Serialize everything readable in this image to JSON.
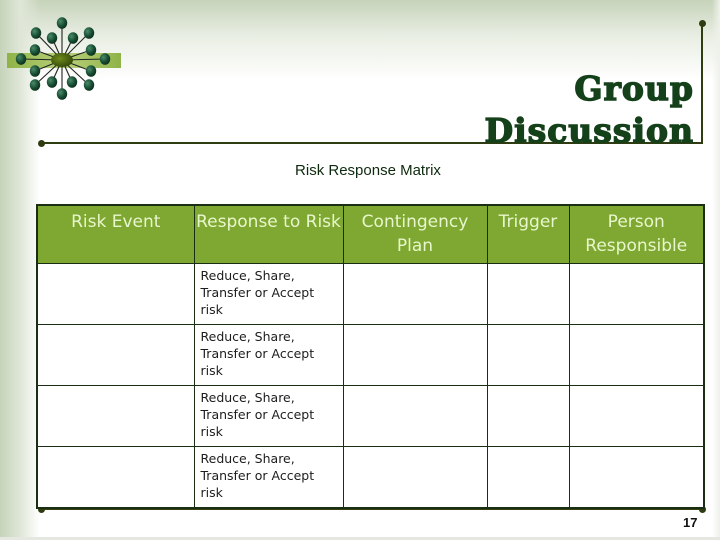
{
  "slide": {
    "title_line1": "Group",
    "title_line2": "Discussion",
    "subtitle": "Risk Response Matrix",
    "page_number": "17",
    "logo": "network-hub-icon"
  },
  "table": {
    "headers": [
      "Risk Event",
      "Response to Risk",
      "Contingency Plan",
      "Trigger",
      "Person Responsible"
    ],
    "rows": [
      [
        "",
        "Reduce, Share, Transfer or Accept risk",
        "",
        "",
        ""
      ],
      [
        "",
        "Reduce, Share, Transfer or Accept risk",
        "",
        "",
        ""
      ],
      [
        "",
        "Reduce, Share, Transfer or Accept risk",
        "",
        "",
        ""
      ],
      [
        "",
        "Reduce, Share, Transfer or Accept risk",
        "",
        "",
        ""
      ]
    ]
  },
  "colors": {
    "header_fill": "#7ea832",
    "header_text": "#e9f6cc",
    "title_text": "#14401a",
    "border": "#1a2e14"
  }
}
